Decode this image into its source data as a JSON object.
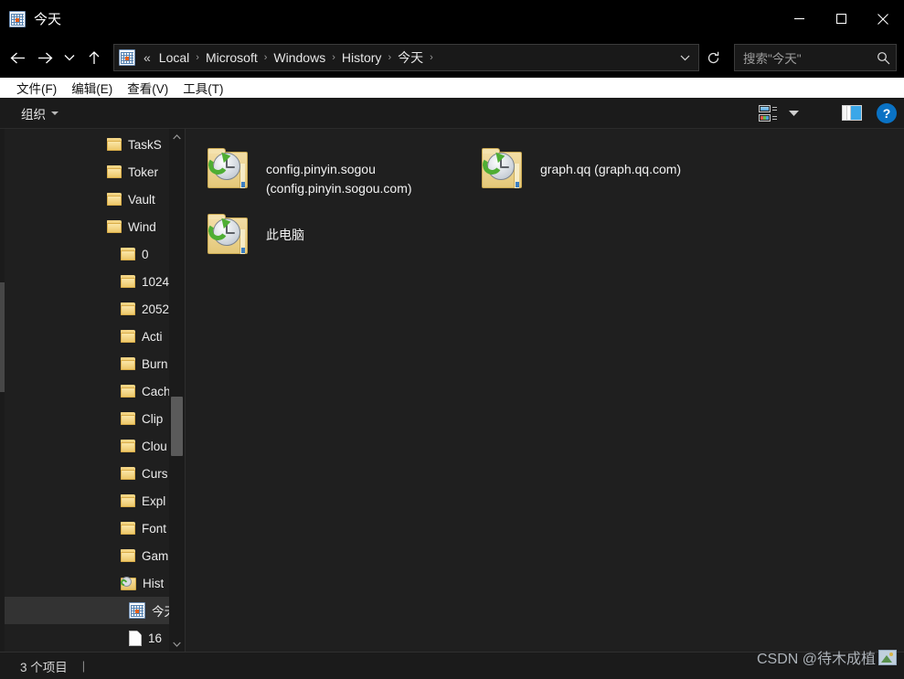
{
  "window": {
    "title": "今天",
    "title_icon": "calendar-today-icon",
    "controls": {
      "minimize": "minimize-icon",
      "maximize": "maximize-icon",
      "close": "close-icon"
    }
  },
  "nav": {
    "back": "back-arrow-icon",
    "forward": "forward-arrow-icon",
    "recent": "chevron-down-icon",
    "up": "up-arrow-icon",
    "breadcrumb_icon": "calendar-today-icon",
    "ellipsis": "«",
    "crumbs": [
      "Local",
      "Microsoft",
      "Windows",
      "History",
      "今天"
    ],
    "separator": "›",
    "dropdown": "chevron-down-icon",
    "refresh": "refresh-icon"
  },
  "search": {
    "placeholder": "搜索\"今天\"",
    "icon": "search-icon"
  },
  "menubar": {
    "items": [
      {
        "label": "文件(F)",
        "name": "menu-file"
      },
      {
        "label": "编辑(E)",
        "name": "menu-edit"
      },
      {
        "label": "查看(V)",
        "name": "menu-view"
      },
      {
        "label": "工具(T)",
        "name": "menu-tools"
      }
    ]
  },
  "commandbar": {
    "organize": "组织",
    "view_options_icon": "view-options-icon",
    "view_dropdown_icon": "chevron-down-icon",
    "preview_pane_icon": "preview-pane-icon",
    "help_label": "?"
  },
  "navpane": {
    "items": [
      {
        "label": "TaskS",
        "icon": "folder-icon",
        "indent": 1,
        "selected": false
      },
      {
        "label": "Toker",
        "icon": "folder-icon",
        "indent": 1,
        "selected": false
      },
      {
        "label": "Vault",
        "icon": "folder-icon",
        "indent": 1,
        "selected": false
      },
      {
        "label": "Wind",
        "icon": "folder-icon",
        "indent": 1,
        "selected": false
      },
      {
        "label": "0",
        "icon": "folder-icon",
        "indent": 2,
        "selected": false
      },
      {
        "label": "1024",
        "icon": "folder-icon",
        "indent": 2,
        "selected": false
      },
      {
        "label": "2052",
        "icon": "folder-icon",
        "indent": 2,
        "selected": false
      },
      {
        "label": "Acti",
        "icon": "folder-icon",
        "indent": 2,
        "selected": false
      },
      {
        "label": "Burn",
        "icon": "folder-icon",
        "indent": 2,
        "selected": false
      },
      {
        "label": "Cach",
        "icon": "folder-icon",
        "indent": 2,
        "selected": false
      },
      {
        "label": "Clip",
        "icon": "folder-icon",
        "indent": 2,
        "selected": false
      },
      {
        "label": "Clou",
        "icon": "folder-icon",
        "indent": 2,
        "selected": false
      },
      {
        "label": "Curs",
        "icon": "folder-icon",
        "indent": 2,
        "selected": false
      },
      {
        "label": "Expl",
        "icon": "folder-icon",
        "indent": 2,
        "selected": false
      },
      {
        "label": "Font",
        "icon": "folder-icon",
        "indent": 2,
        "selected": false
      },
      {
        "label": "Gam",
        "icon": "folder-icon",
        "indent": 2,
        "selected": false
      },
      {
        "label": "Hist",
        "icon": "history-folder-icon",
        "indent": 2,
        "selected": false
      },
      {
        "label": "今天",
        "icon": "calendar-today-icon",
        "indent": 3,
        "selected": true
      },
      {
        "label": "16",
        "icon": "file-icon",
        "indent": 3,
        "selected": false
      }
    ],
    "scroll_up_icon": "chevron-up-icon",
    "scroll_down_icon": "chevron-down-icon"
  },
  "content": {
    "items": [
      {
        "name": "config.pinyin.sogou (config.pinyin.sogou.com)",
        "icon": "history-folder-icon"
      },
      {
        "name": "graph.qq (graph.qq.com)",
        "icon": "history-folder-icon"
      },
      {
        "name": "此电脑",
        "icon": "history-folder-icon"
      }
    ]
  },
  "statusbar": {
    "count": "3 个项目",
    "separator": "|"
  },
  "watermark": {
    "text": "CSDN @待木成植",
    "badge_icon": "image-badge-icon"
  },
  "colors": {
    "window_bg": "#1f1f1f",
    "titlebar_bg": "#000000",
    "menubar_bg": "#ffffff",
    "accent_blue": "#0a72c4",
    "selection": "#333333",
    "text": "#ececec"
  }
}
